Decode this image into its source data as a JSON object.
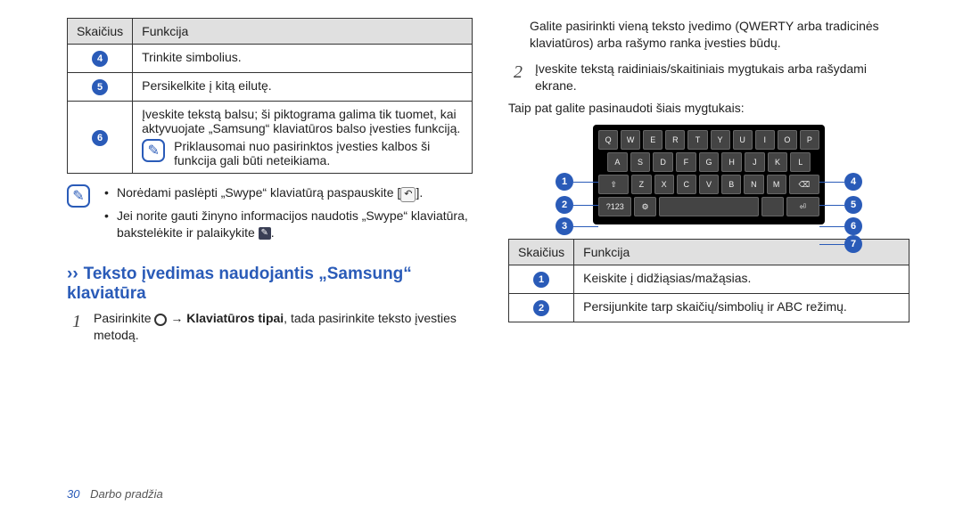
{
  "table_a": {
    "head_num": "Skaičius",
    "head_func": "Funkcija",
    "rows": [
      {
        "n": "4",
        "text": "Trinkite simbolius."
      },
      {
        "n": "5",
        "text": "Persikelkite į kitą eilutę."
      },
      {
        "n": "6",
        "text": "Įveskite tekstą balsu; ši piktograma galima tik tuomet, kai aktyvuojate „Samsung“ klaviatūros balso įvesties funkciją.",
        "note": "Priklausomai nuo pasirinktos įvesties kalbos ši funkcija gali būti neteikiama."
      }
    ]
  },
  "notes": {
    "b1": "Norėdami paslėpti „Swype“ klaviatūrą paspauskite [",
    "b1_key": "↶",
    "b1_suffix": "].",
    "b2_prefix": "Jei norite gauti žinyno informacijos naudotis „Swype“ klaviatūra, bakstelėkite ir palaikykite ",
    "b2_suffix": "."
  },
  "section": {
    "chevron": "››",
    "title": "Teksto įvedimas naudojantis „Samsung“ klaviatūra"
  },
  "step1": {
    "num": "1",
    "prefix": "Pasirinkite ",
    "arrow": " → ",
    "bold": "Klaviatūros tipai",
    "suffix": ", tada pasirinkite teksto įvesties metodą."
  },
  "right_intro": "Galite pasirinkti vieną teksto įvedimo (QWERTY arba tradicinės klaviatūros) arba rašymo ranka įvesties būdų.",
  "step2": {
    "num": "2",
    "text": "Įveskite tekstą raidiniais/skaitiniais mygtukais arba rašydami ekrane."
  },
  "right_para": "Taip pat galite pasinaudoti šiais mygtukais:",
  "kbd": {
    "r1": [
      "Q",
      "W",
      "E",
      "R",
      "T",
      "Y",
      "U",
      "I",
      "O",
      "P"
    ],
    "r2": [
      "A",
      "S",
      "D",
      "F",
      "G",
      "H",
      "J",
      "K",
      "L"
    ],
    "r3": [
      "⇧",
      "Z",
      "X",
      "C",
      "V",
      "B",
      "N",
      "M",
      "⌫"
    ],
    "r4": [
      "?123",
      "⚙",
      "",
      "",
      "⏎"
    ]
  },
  "callouts": {
    "c1": "1",
    "c2": "2",
    "c3": "3",
    "c4": "4",
    "c5": "5",
    "c6": "6",
    "c7": "7"
  },
  "table_b": {
    "head_num": "Skaičius",
    "head_func": "Funkcija",
    "rows": [
      {
        "n": "1",
        "text": "Keiskite į didžiąsias/mažąsias."
      },
      {
        "n": "2",
        "text": "Persijunkite tarp skaičių/simbolių ir ABC režimų."
      }
    ]
  },
  "footer": {
    "page": "30",
    "section": "Darbo pradžia"
  }
}
